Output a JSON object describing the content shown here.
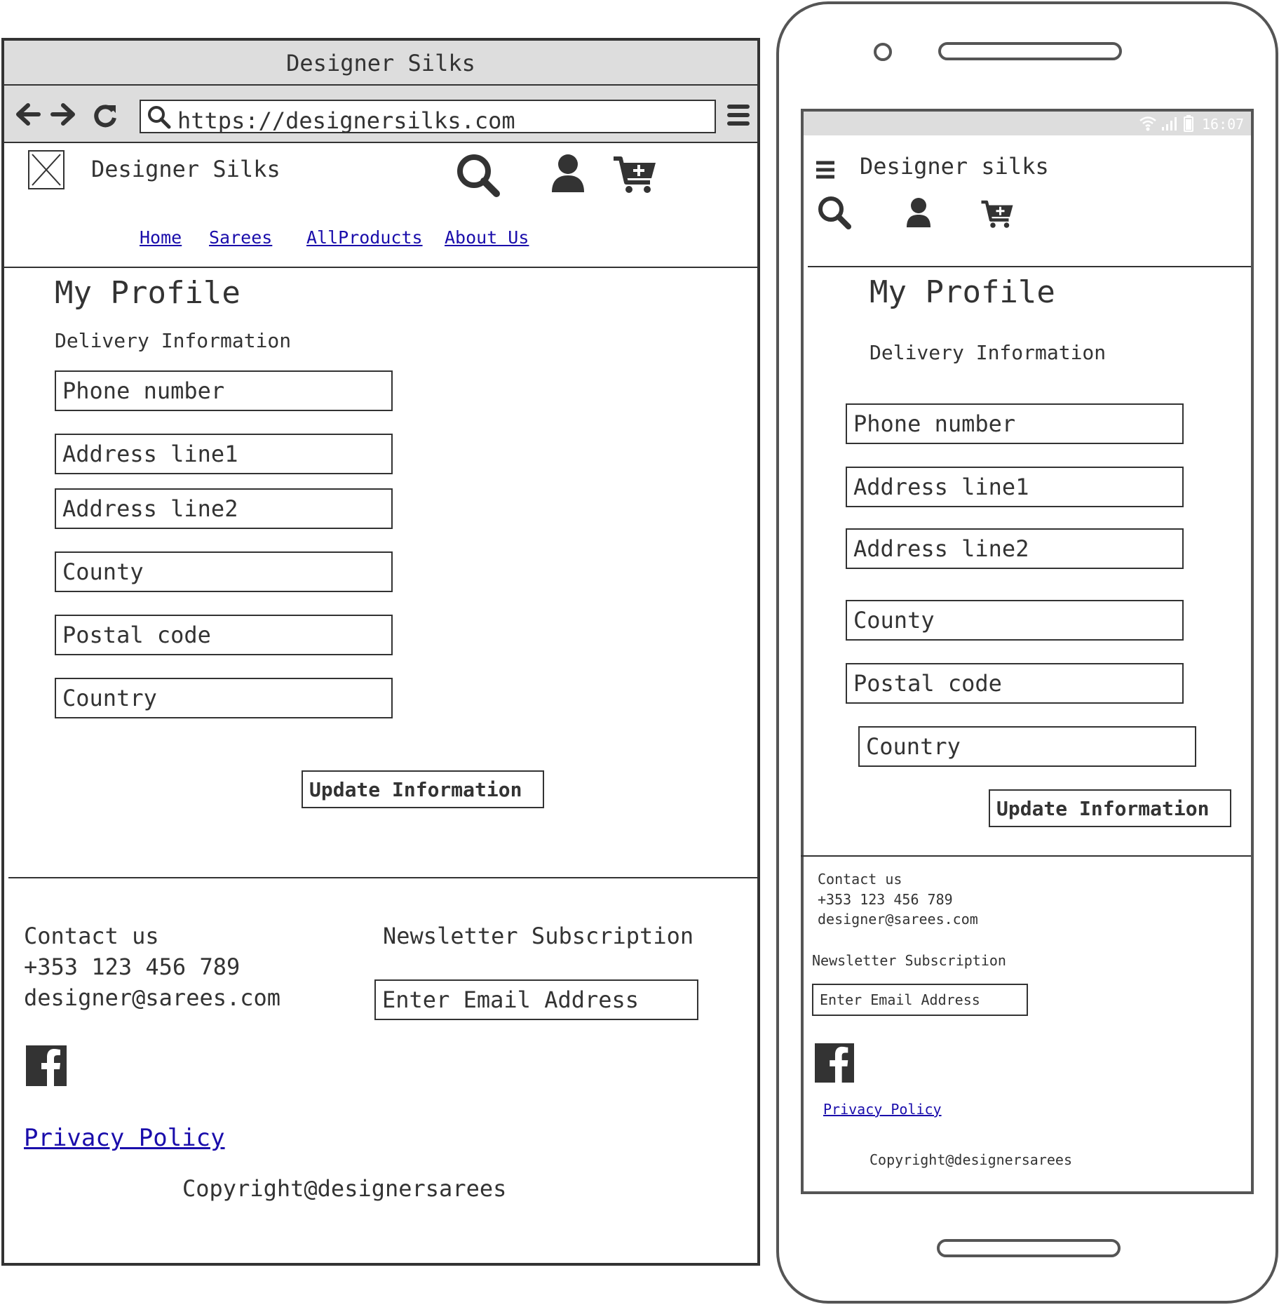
{
  "desktop": {
    "window_title": "Designer Silks",
    "url": "https://designersilks.com",
    "site_name": "Designer Silks",
    "nav": [
      "Home",
      "Sarees",
      "AllProducts",
      "About Us"
    ],
    "page_title": "My Profile",
    "section_title": "Delivery Information",
    "fields": [
      "Phone number",
      "Address line1",
      "Address line2",
      "County",
      "Postal code",
      "Country"
    ],
    "update_button": "Update Information",
    "footer": {
      "contact_heading": "Contact us",
      "phone": "+353 123 456 789",
      "email": "designer@sarees.com",
      "newsletter_heading": "Newsletter Subscription",
      "email_placeholder": "Enter Email Address",
      "privacy_link": "Privacy Policy",
      "copyright": "Copyright@designersarees"
    }
  },
  "mobile": {
    "status_time": "16:07",
    "site_name": "Designer silks",
    "page_title": "My Profile",
    "section_title": "Delivery Information",
    "fields": [
      "Phone number",
      "Address line1",
      "Address line2",
      "County",
      "Postal code",
      "Country"
    ],
    "update_button": "Update Information",
    "footer": {
      "contact_heading": "Contact us",
      "phone": "+353 123 456 789",
      "email": "designer@sarees.com",
      "newsletter_heading": "Newsletter Subscription",
      "email_placeholder": "Enter Email Address",
      "privacy_link": "Privacy Policy",
      "copyright": "Copyright@designersarees"
    }
  },
  "icons": [
    "back-arrow-icon",
    "forward-arrow-icon",
    "reload-icon",
    "search-icon",
    "menu-icon",
    "image-placeholder-icon",
    "user-icon",
    "cart-add-icon",
    "facebook-icon",
    "hamburger-icon",
    "wifi-icon",
    "signal-icon",
    "battery-icon"
  ],
  "colors": {
    "ink": "#333333",
    "chrome": "#dddddd",
    "link": "#1a0dab"
  }
}
